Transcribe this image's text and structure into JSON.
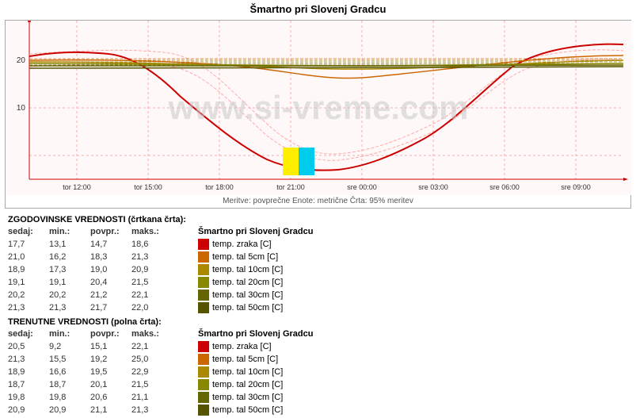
{
  "title": "Šmartno pri Slovenj Gradcu",
  "watermark": "www.si-vreme.com",
  "subtitle1": "Meritve: povprečne  Enote: metrične  Črta: 95% meritev",
  "xLabels": [
    "tor 12:00",
    "tor 15:00",
    "tor 18:00",
    "tor 21:00",
    "sre 00:00",
    "sre 03:00",
    "sre 06:00",
    "sre 09:00"
  ],
  "yLabels": [
    "10",
    "20"
  ],
  "historical": {
    "header": "ZGODOVINSKE VREDNOSTI (črtkana črta):",
    "colHeaders": [
      "sedaj:",
      "min.:",
      "povpr.:",
      "maks.:"
    ],
    "rows": [
      {
        "sedaj": "17,7",
        "min": "13,1",
        "povpr": "14,7",
        "maks": "18,6"
      },
      {
        "sedaj": "21,0",
        "min": "16,2",
        "povpr": "18,3",
        "maks": "21,3"
      },
      {
        "sedaj": "18,9",
        "min": "17,3",
        "povpr": "19,0",
        "maks": "20,9"
      },
      {
        "sedaj": "19,1",
        "min": "19,1",
        "povpr": "20,4",
        "maks": "21,5"
      },
      {
        "sedaj": "20,2",
        "min": "20,2",
        "povpr": "21,2",
        "maks": "22,1"
      },
      {
        "sedaj": "21,3",
        "min": "21,3",
        "povpr": "21,7",
        "maks": "22,0"
      }
    ],
    "rightHeader": "Šmartno pri Slovenj Gradcu",
    "rightRows": [
      {
        "color": "#cc0000",
        "label": "temp. zraka [C]"
      },
      {
        "color": "#cc6600",
        "label": "temp. tal  5cm [C]"
      },
      {
        "color": "#aa8800",
        "label": "temp. tal 10cm [C]"
      },
      {
        "color": "#888800",
        "label": "temp. tal 20cm [C]"
      },
      {
        "color": "#666600",
        "label": "temp. tal 30cm [C]"
      },
      {
        "color": "#555500",
        "label": "temp. tal 50cm [C]"
      }
    ]
  },
  "current": {
    "header": "TRENUTNE VREDNOSTI (polna črta):",
    "colHeaders": [
      "sedaj:",
      "min.:",
      "povpr.:",
      "maks.:"
    ],
    "rows": [
      {
        "sedaj": "20,5",
        "min": "9,2",
        "povpr": "15,1",
        "maks": "22,1"
      },
      {
        "sedaj": "21,3",
        "min": "15,5",
        "povpr": "19,2",
        "maks": "25,0"
      },
      {
        "sedaj": "18,9",
        "min": "16,6",
        "povpr": "19,5",
        "maks": "22,9"
      },
      {
        "sedaj": "18,7",
        "min": "18,7",
        "povpr": "20,1",
        "maks": "21,5"
      },
      {
        "sedaj": "19,8",
        "min": "19,8",
        "povpr": "20,6",
        "maks": "21,1"
      },
      {
        "sedaj": "20,9",
        "min": "20,9",
        "povpr": "21,1",
        "maks": "21,3"
      }
    ],
    "rightHeader": "Šmartno pri Slovenj Gradcu",
    "rightRows": [
      {
        "color": "#cc0000",
        "label": "temp. zraka [C]"
      },
      {
        "color": "#cc6600",
        "label": "temp. tal  5cm [C]"
      },
      {
        "color": "#aa8800",
        "label": "temp. tal 10cm [C]"
      },
      {
        "color": "#888800",
        "label": "temp. tal 20cm [C]"
      },
      {
        "color": "#666600",
        "label": "temp. tal 30cm [C]"
      },
      {
        "color": "#555500",
        "label": "temp. tal 50cm [C]"
      }
    ]
  },
  "colors": {
    "background": "#fff",
    "gridLine": "#ddaaaa",
    "axisLine": "#cc0000"
  }
}
